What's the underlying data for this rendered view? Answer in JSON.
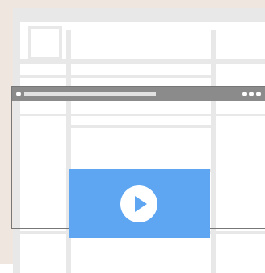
{
  "colors": {
    "background": "#efe7df",
    "page": "#ffffff",
    "block": "#e8e8e8",
    "window_frame": "#777777",
    "window_bar": "#8b8b8b",
    "accent": "#5ea6f2"
  },
  "icons": {
    "browser_left": "window-dot-icon",
    "browser_right": "window-controls-icon",
    "media": "play-icon"
  }
}
